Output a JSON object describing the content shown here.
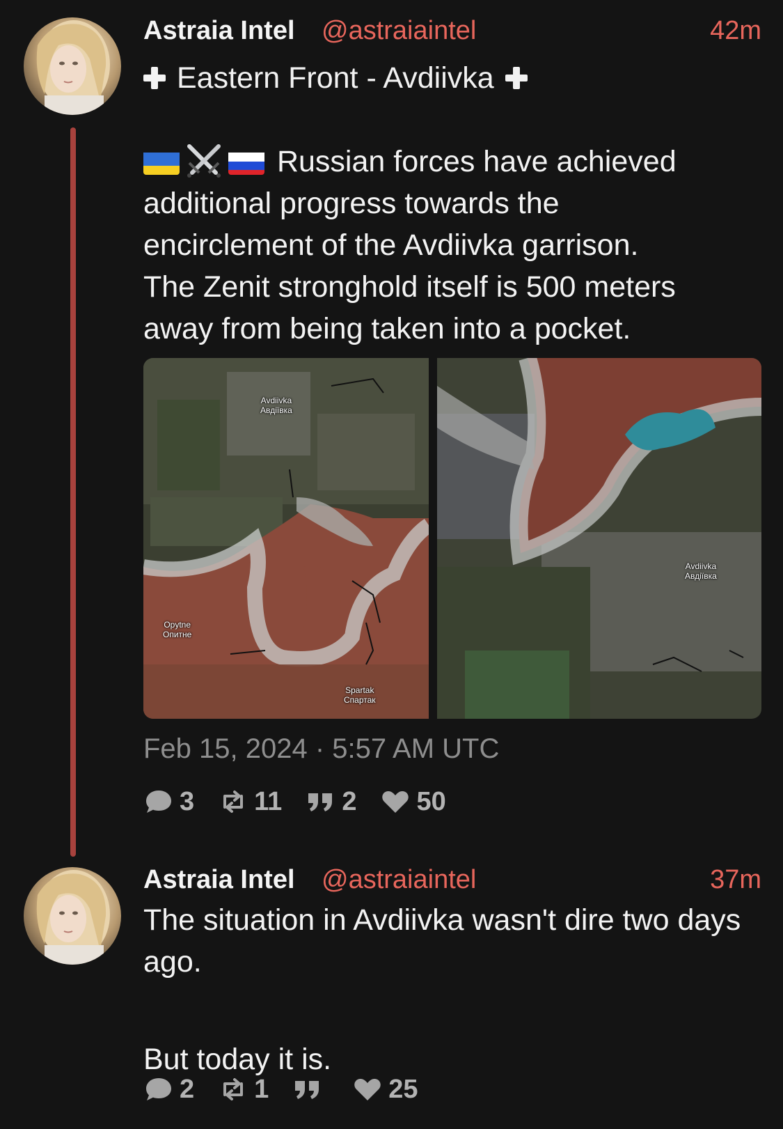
{
  "posts": [
    {
      "author": "Astraia Intel",
      "handle": "@astraiaintel",
      "time": "42m",
      "title": "Eastern Front -  Avdiivka",
      "body": "Russian forces have achieved additional progress towards the encirclement of the Avdiivka garrison. The Zenit stronghold itself is 500 meters away from being taken into a pocket.",
      "body_lines": [
        "Russian forces have achieved",
        "additional progress towards the",
        "encirclement of the Avdiivka garrison.",
        "The Zenit stronghold itself is 500 meters",
        "away from being taken into a pocket."
      ],
      "emoji": [
        "flag-ukraine-icon",
        "crossed-swords-icon",
        "flag-russia-icon"
      ],
      "map_left_labels": {
        "avdiivka_en": "Avdiivka",
        "avdiivka_uk": "Авдіївка",
        "opytne_en": "Opytne",
        "opytne_uk": "Опитне",
        "spartak_en": "Spartak",
        "spartak_uk": "Спартак"
      },
      "map_right_labels": {
        "avdiivka_en": "Avdiivka",
        "avdiivka_uk": "Авдіївка"
      },
      "timestamp": "Feb 15, 2024 · 5:57 AM UTC",
      "stats": {
        "replies": "3",
        "reposts": "11",
        "quotes": "2",
        "likes": "50"
      }
    },
    {
      "author": "Astraia Intel",
      "handle": "@astraiaintel",
      "time": "37m",
      "body_lines": [
        "The situation in Avdiivka wasn't dire two days",
        "ago."
      ],
      "body_line_2": "But today it is.",
      "stats": {
        "replies": "2",
        "reposts": "1",
        "quotes": "",
        "likes": "25"
      }
    }
  ],
  "colors": {
    "background": "#141414",
    "accent": "#e8665c",
    "thread_line": "#a8423d",
    "muted": "#8e8e8e"
  }
}
